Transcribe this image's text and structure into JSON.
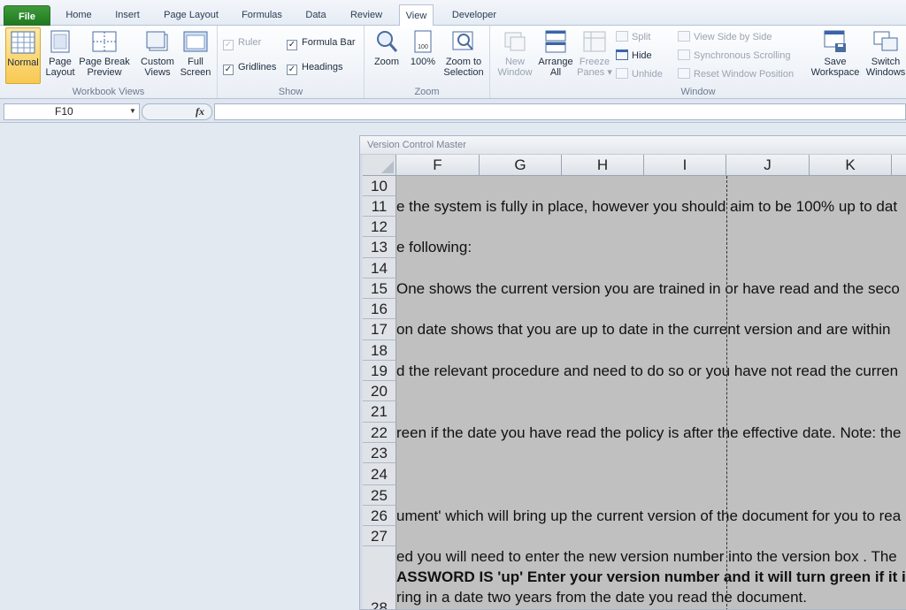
{
  "tabs": {
    "file": "File",
    "home": "Home",
    "insert": "Insert",
    "page_layout": "Page Layout",
    "formulas": "Formulas",
    "data": "Data",
    "review": "Review",
    "view": "View",
    "developer": "Developer"
  },
  "ribbon": {
    "workbook_views": {
      "label": "Workbook Views",
      "normal": "Normal",
      "page_layout": [
        "Page",
        "Layout"
      ],
      "page_break_preview": [
        "Page Break",
        "Preview"
      ],
      "custom_views": [
        "Custom",
        "Views"
      ],
      "full_screen": [
        "Full",
        "Screen"
      ]
    },
    "show": {
      "label": "Show",
      "ruler": "Ruler",
      "gridlines": "Gridlines",
      "formula_bar": "Formula Bar",
      "headings": "Headings",
      "ruler_checked": true,
      "gridlines_checked": true,
      "formula_bar_checked": true,
      "headings_checked": true
    },
    "zoom": {
      "label": "Zoom",
      "zoom": "Zoom",
      "hundred": "100%",
      "zoom_to_selection": [
        "Zoom to",
        "Selection"
      ]
    },
    "window": {
      "label": "Window",
      "new_window": [
        "New",
        "Window"
      ],
      "arrange_all": [
        "Arrange",
        "All"
      ],
      "freeze_panes": [
        "Freeze",
        "Panes ▾"
      ],
      "split": "Split",
      "hide": "Hide",
      "unhide": "Unhide",
      "view_side_by_side": "View Side by Side",
      "synchronous_scrolling": "Synchronous Scrolling",
      "reset_window_position": "Reset Window Position",
      "save_workspace": [
        "Save",
        "Workspace"
      ],
      "switch_windows": [
        "Switch",
        "Windows"
      ]
    }
  },
  "formula_bar": {
    "name_box": "F10",
    "fx": "fx",
    "formula": ""
  },
  "window": {
    "title": "Version Control Master",
    "columns": [
      "F",
      "G",
      "H",
      "I",
      "J",
      "K"
    ],
    "rows": [
      {
        "num": "10",
        "text": ""
      },
      {
        "num": "11",
        "text": "e the system is fully in place, however you should aim to be 100% up to dat"
      },
      {
        "num": "12",
        "text": ""
      },
      {
        "num": "13",
        "text": "e following:"
      },
      {
        "num": "14",
        "text": ""
      },
      {
        "num": "15",
        "text": "One shows the current version you are trained in or have read and the seco"
      },
      {
        "num": "16",
        "text": ""
      },
      {
        "num": "17",
        "text": "on date shows that you are up to date in the current version and are within"
      },
      {
        "num": "18",
        "text": ""
      },
      {
        "num": "19",
        "text": "d the relevant procedure and need to do so or you have not read the curren"
      },
      {
        "num": "20",
        "text": ""
      },
      {
        "num": "21",
        "text": ""
      },
      {
        "num": "22",
        "text": "reen if the date you have read the policy is after the effective date. Note: the"
      },
      {
        "num": "23",
        "text": ""
      },
      {
        "num": "24",
        "text": ""
      },
      {
        "num": "25",
        "text": ""
      },
      {
        "num": "26",
        "text": "ument' which will bring up the current version of the document for you to rea"
      },
      {
        "num": "27",
        "text": ""
      },
      {
        "num": "28",
        "lines": [
          "ed you will need to enter the new version number into the version box . The",
          "ASSWORD IS 'up' Enter your version number and it will turn green if it is th",
          "ring in a date two years from the date you read the document."
        ]
      }
    ]
  },
  "colors": {
    "file_tab": "#2a8a2a",
    "selected_button": "#f8c951",
    "sheet_background": "#c0c0c0"
  }
}
